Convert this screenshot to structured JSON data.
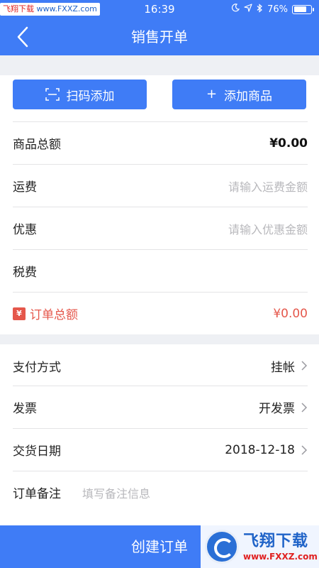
{
  "status_bar": {
    "watermark": {
      "part1": "飞翔下载",
      "part2": "www.FXXZ.com"
    },
    "time": "16:39",
    "battery_text": "76%",
    "battery_level": 0.76
  },
  "navbar": {
    "title": "销售开单"
  },
  "actions": {
    "scan_label": "扫码添加",
    "add_label": "添加商品",
    "add_prefix": "+"
  },
  "totals": {
    "goods_total_label": "商品总额",
    "goods_total_value": "¥0.00",
    "shipping_label": "运费",
    "shipping_placeholder": "请输入运费金额",
    "discount_label": "优惠",
    "discount_placeholder": "请输入优惠金额",
    "tax_label": "税费",
    "order_total_label": "订单总额",
    "order_total_value": "¥0.00",
    "order_total_icon_glyph": "¥"
  },
  "details": {
    "payment_label": "支付方式",
    "payment_value": "挂帐",
    "invoice_label": "发票",
    "invoice_value": "开发票",
    "delivery_label": "交货日期",
    "delivery_value": "2018-12-18",
    "note_label": "订单备注",
    "note_placeholder": "填写备注信息"
  },
  "footer": {
    "create_label": "创建订单",
    "watermark_big": "飞翔下载",
    "watermark_small": "www.FXXZ.com"
  },
  "colors": {
    "primary": "#3f7cf6",
    "accent_red": "#e5574b",
    "divider": "#e4e4e6",
    "section_gap": "#eef0f4"
  },
  "icons": [
    "back-chevron-icon",
    "scan-icon",
    "plus-icon",
    "ticket-icon",
    "chevron-right-icon",
    "location-arrow-icon",
    "bluetooth-icon",
    "moon-icon",
    "battery-icon"
  ]
}
